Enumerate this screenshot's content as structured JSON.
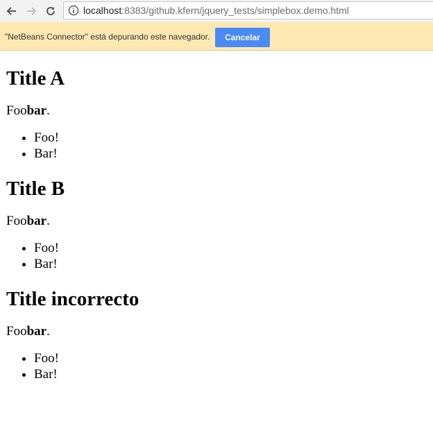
{
  "browser": {
    "url_host": "localhost",
    "url_rest": ":8383/github.kfern/jquery_tests/simplebox.demo.html",
    "icons": [
      "back-icon",
      "forward-icon",
      "reload-icon",
      "info-icon"
    ]
  },
  "infobar": {
    "message": "\"NetBeans Connector\" está depurando este navegador.",
    "cancel_label": "Cancelar",
    "colors": {
      "background": "#fce8b0",
      "button": "#4a8af4"
    }
  },
  "sections": [
    {
      "title": "Title A",
      "para_prefix": "Foo",
      "para_bold": "bar",
      "para_suffix": ".",
      "items": [
        "Foo!",
        "Bar!"
      ]
    },
    {
      "title": "Title B",
      "para_prefix": "Foo",
      "para_bold": "bar",
      "para_suffix": ".",
      "items": [
        "Foo!",
        "Bar!"
      ]
    },
    {
      "title": "Title incorrecto",
      "para_prefix": "Foo",
      "para_bold": "bar",
      "para_suffix": ".",
      "items": [
        "Foo!",
        "Bar!"
      ]
    }
  ]
}
